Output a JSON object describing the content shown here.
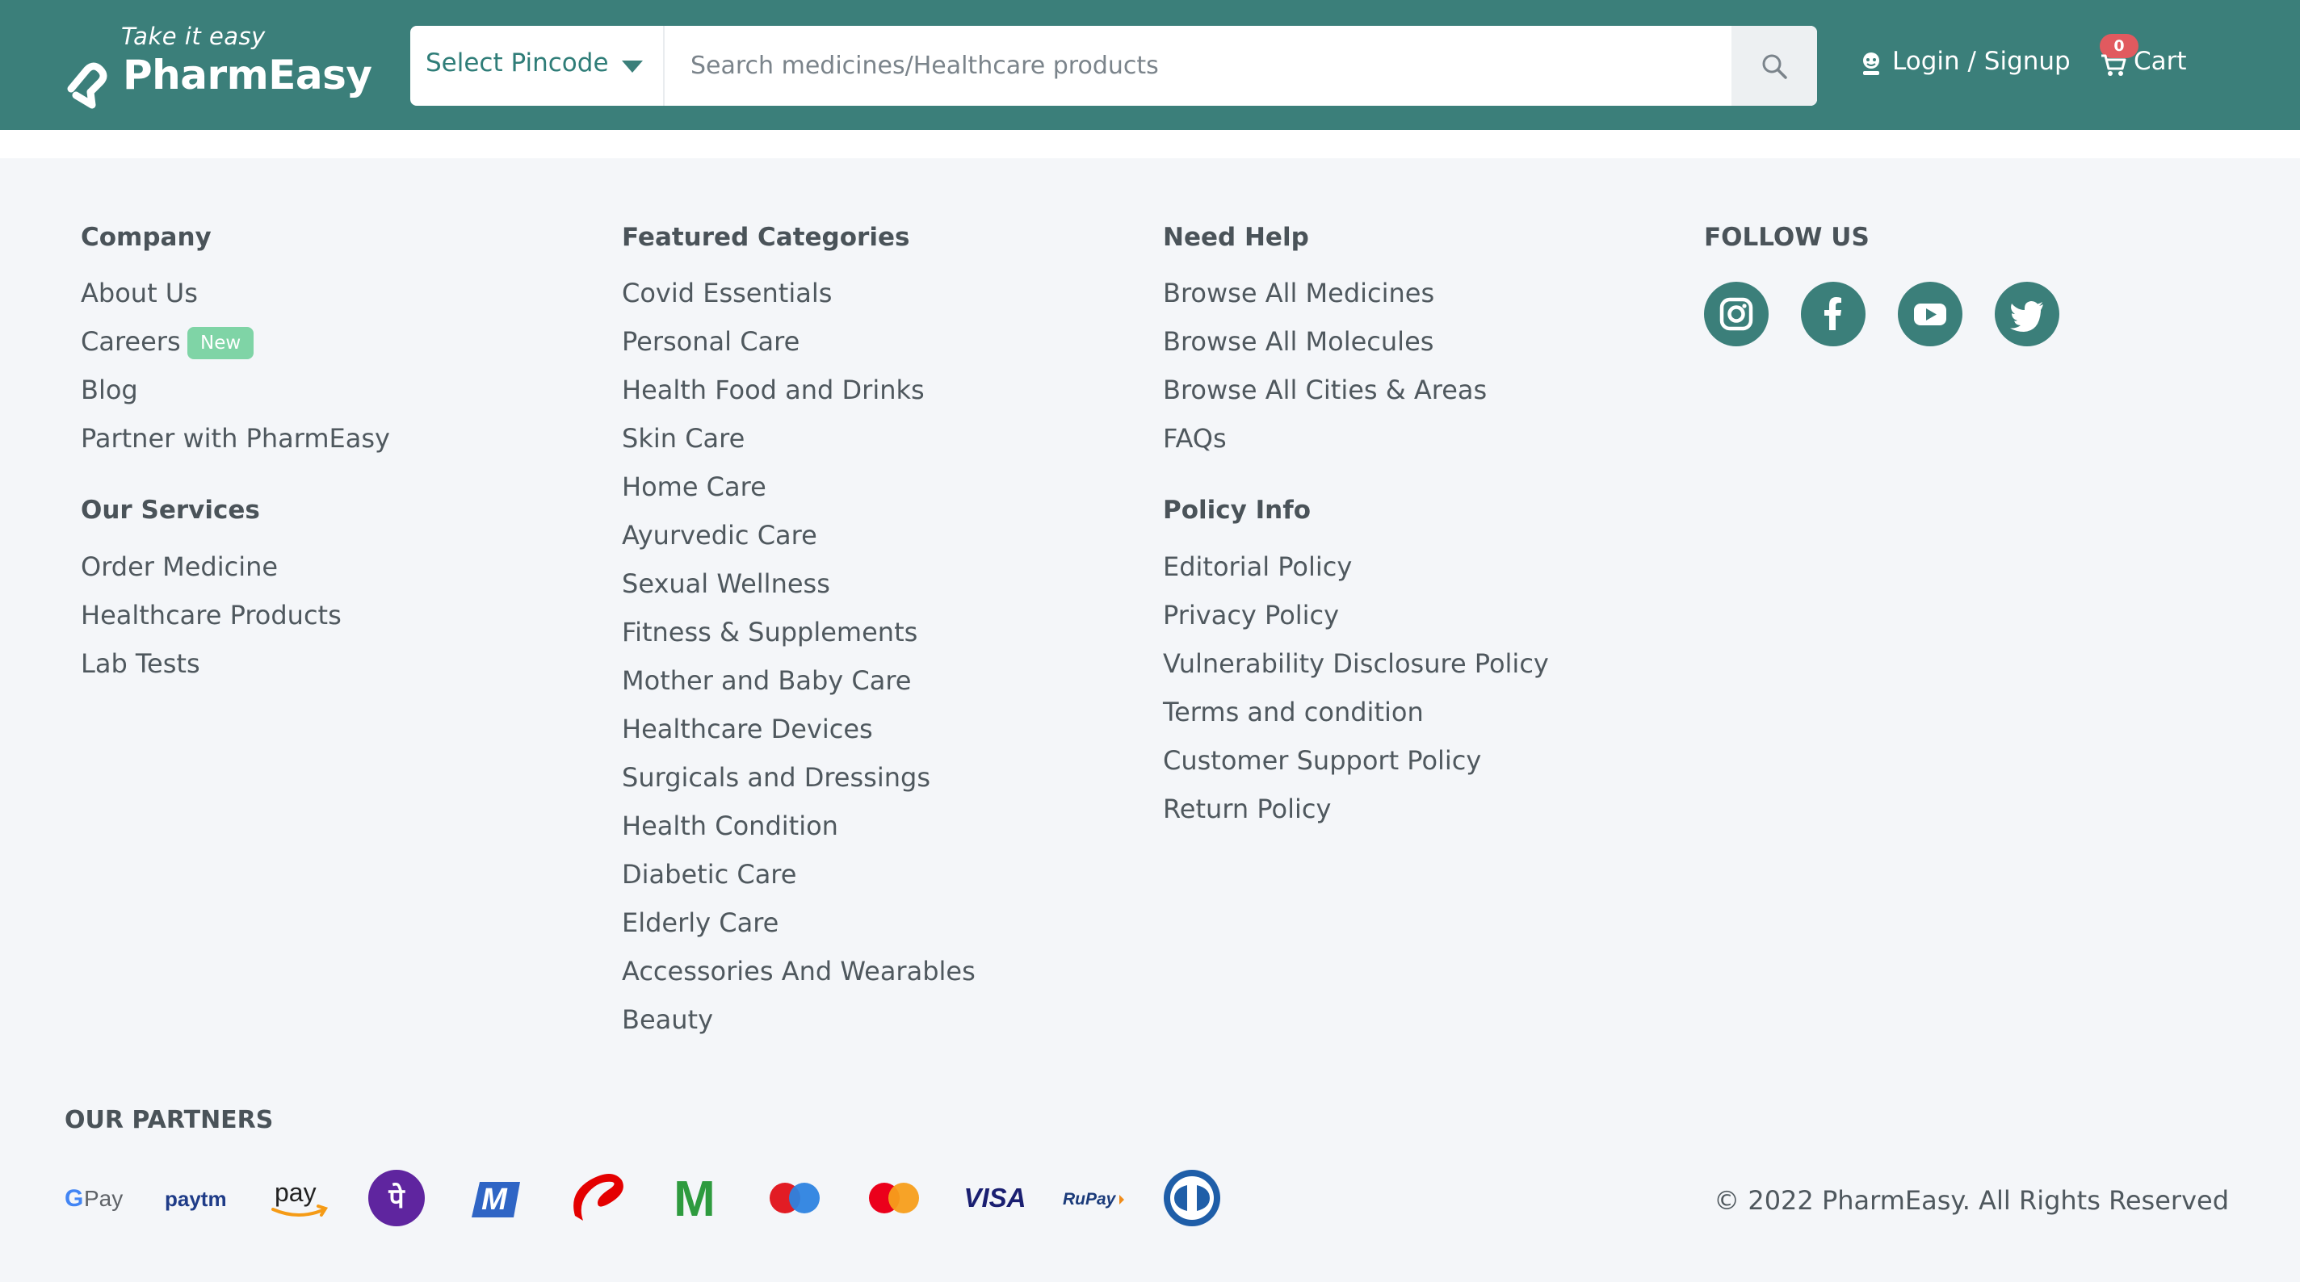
{
  "header": {
    "logo": {
      "tagline": "Take it easy",
      "name": "PharmEasy"
    },
    "pincode_label": "Select Pincode",
    "search_placeholder": "Search medicines/Healthcare products",
    "login_label": "Login / Signup",
    "cart": {
      "label": "Cart",
      "count": "0"
    },
    "brand_color": "#3b7f7a"
  },
  "footer": {
    "company": {
      "heading": "Company",
      "links": [
        "About Us",
        "Careers",
        "Blog",
        "Partner with PharmEasy"
      ],
      "new_badge": "New"
    },
    "services": {
      "heading": "Our Services",
      "links": [
        "Order Medicine",
        "Healthcare Products",
        "Lab Tests"
      ]
    },
    "featured": {
      "heading": "Featured Categories",
      "links": [
        "Covid Essentials",
        "Personal Care",
        "Health Food and Drinks",
        "Skin Care",
        "Home Care",
        "Ayurvedic Care",
        "Sexual Wellness",
        "Fitness & Supplements",
        "Mother and Baby Care",
        "Healthcare Devices",
        "Surgicals and Dressings",
        "Health Condition",
        "Diabetic Care",
        "Elderly Care",
        "Accessories And Wearables",
        "Beauty"
      ]
    },
    "help": {
      "heading": "Need Help",
      "links": [
        "Browse All Medicines",
        "Browse All Molecules",
        "Browse All Cities & Areas",
        "FAQs"
      ]
    },
    "policy": {
      "heading": "Policy Info",
      "links": [
        "Editorial Policy",
        "Privacy Policy",
        "Vulnerability Disclosure Policy",
        "Terms and condition",
        "Customer Support Policy",
        "Return Policy"
      ]
    },
    "follow": {
      "heading": "FOLLOW US",
      "icons": [
        "instagram-icon",
        "facebook-icon",
        "youtube-icon",
        "twitter-icon"
      ]
    },
    "partners": {
      "heading": "OUR PARTNERS",
      "logos": [
        {
          "name": "Google Pay",
          "g": "G",
          "text": "Pay"
        },
        {
          "name": "Paytm",
          "text": "paytm"
        },
        {
          "name": "Amazon Pay",
          "text": "pay"
        },
        {
          "name": "PhonePe",
          "text": "पे"
        },
        {
          "name": "MobiKwik",
          "text": "M"
        },
        {
          "name": "Airtel"
        },
        {
          "name": "Myntra-like M",
          "text": "M"
        },
        {
          "name": "Maestro"
        },
        {
          "name": "Mastercard"
        },
        {
          "name": "Visa",
          "text": "VISA"
        },
        {
          "name": "RuPay",
          "text": "RuPay"
        },
        {
          "name": "Diners Club"
        }
      ]
    },
    "copyright": "© 2022 PharmEasy. All Rights Reserved"
  }
}
